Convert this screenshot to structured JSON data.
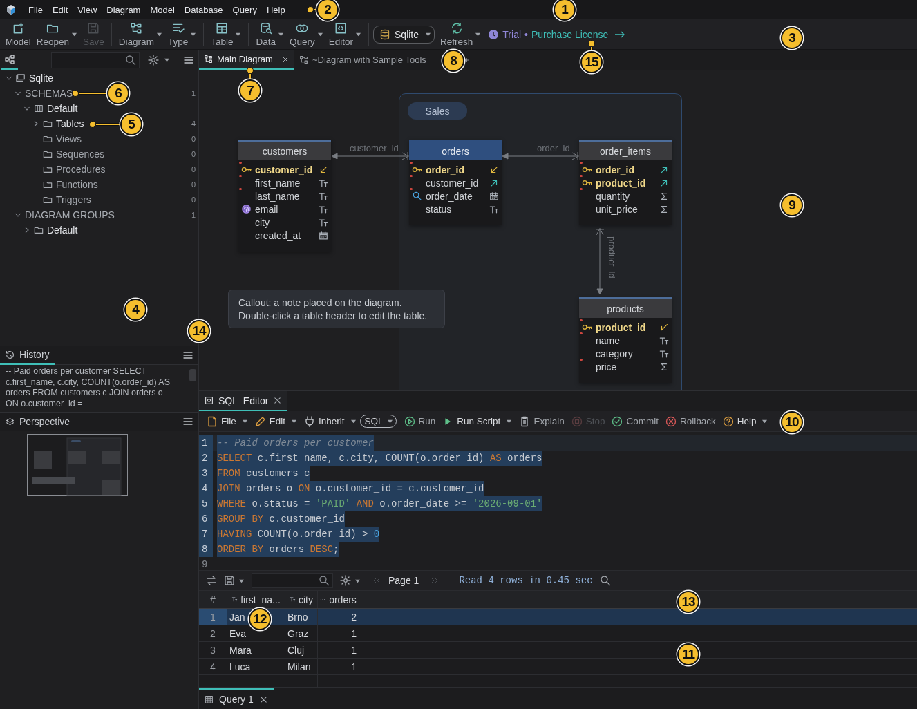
{
  "menu": [
    "File",
    "Edit",
    "View",
    "Diagram",
    "Model",
    "Database",
    "Query",
    "Help"
  ],
  "toolbar": [
    {
      "label": "Model",
      "disabled": false,
      "dropdown": false
    },
    {
      "label": "Reopen",
      "disabled": false,
      "dropdown": true
    },
    {
      "label": "Save",
      "disabled": true,
      "dropdown": false
    },
    {
      "label": "Diagram",
      "disabled": false,
      "dropdown": true
    },
    {
      "label": "Type",
      "disabled": false,
      "dropdown": true
    },
    {
      "label": "Table",
      "disabled": false,
      "dropdown": true
    },
    {
      "label": "Data",
      "disabled": false,
      "dropdown": true
    },
    {
      "label": "Query",
      "disabled": false,
      "dropdown": true
    },
    {
      "label": "Editor",
      "disabled": false,
      "dropdown": true
    }
  ],
  "connection": {
    "label": "Sqlite"
  },
  "refresh": {
    "label": "Refresh"
  },
  "license": {
    "status": "Trial",
    "separator": "•",
    "link": "Purchase License"
  },
  "tree": [
    {
      "label": "Sqlite",
      "expanded": true,
      "children": [
        {
          "label": "SCHEMAS",
          "count": "1",
          "expanded": true,
          "children": [
            {
              "label": "Default",
              "expanded": true,
              "children": [
                {
                  "label": "Tables",
                  "count": "4",
                  "expanded": false
                },
                {
                  "label": "Views",
                  "count": "0"
                },
                {
                  "label": "Sequences",
                  "count": "0"
                },
                {
                  "label": "Procedures",
                  "count": "0"
                },
                {
                  "label": "Functions",
                  "count": "0"
                },
                {
                  "label": "Triggers",
                  "count": "0"
                }
              ]
            }
          ]
        },
        {
          "label": "DIAGRAM GROUPS",
          "count": "1",
          "expanded": true,
          "children": [
            {
              "label": "Default",
              "expanded": false
            }
          ]
        }
      ]
    }
  ],
  "history": {
    "title": "History",
    "text": "-- Paid orders per customer SELECT c.first_name, c.city, COUNT(o.order_id) AS orders FROM customers c JOIN orders o ON o.customer_id ="
  },
  "perspective": {
    "title": "Perspective"
  },
  "diagram_tabs": [
    {
      "label": "Main Diagram",
      "selected": true,
      "closable": true
    },
    {
      "label": "~Diagram with Sample Tools",
      "selected": false,
      "closable": false
    }
  ],
  "diagram": {
    "group": {
      "label": "Sales"
    },
    "tables": [
      {
        "name": "customers",
        "selected": false,
        "columns": [
          {
            "name": "customer_id",
            "key": true,
            "unique": false,
            "indexed": false,
            "required": true,
            "kind": "ref-in"
          },
          {
            "name": "first_name",
            "key": false,
            "unique": false,
            "indexed": false,
            "required": true,
            "kind": "text"
          },
          {
            "name": "last_name",
            "key": false,
            "unique": false,
            "indexed": false,
            "required": true,
            "kind": "text"
          },
          {
            "name": "email",
            "key": false,
            "unique": true,
            "indexed": false,
            "required": false,
            "kind": "text"
          },
          {
            "name": "city",
            "key": false,
            "unique": false,
            "indexed": false,
            "required": false,
            "kind": "text"
          },
          {
            "name": "created_at",
            "key": false,
            "unique": false,
            "indexed": false,
            "required": false,
            "kind": "date"
          }
        ]
      },
      {
        "name": "orders",
        "selected": true,
        "columns": [
          {
            "name": "order_id",
            "key": true,
            "unique": false,
            "indexed": false,
            "required": true,
            "kind": "ref-in"
          },
          {
            "name": "customer_id",
            "key": false,
            "unique": false,
            "indexed": false,
            "required": true,
            "kind": "ref-out"
          },
          {
            "name": "order_date",
            "key": false,
            "unique": false,
            "indexed": true,
            "required": true,
            "kind": "date"
          },
          {
            "name": "status",
            "key": false,
            "unique": false,
            "indexed": false,
            "required": false,
            "kind": "text"
          }
        ]
      },
      {
        "name": "order_items",
        "selected": false,
        "columns": [
          {
            "name": "order_id",
            "key": true,
            "unique": false,
            "indexed": false,
            "required": true,
            "kind": "ref-out"
          },
          {
            "name": "product_id",
            "key": true,
            "unique": false,
            "indexed": false,
            "required": true,
            "kind": "ref-out"
          },
          {
            "name": "quantity",
            "key": false,
            "unique": false,
            "indexed": false,
            "required": true,
            "kind": "number"
          },
          {
            "name": "unit_price",
            "key": false,
            "unique": false,
            "indexed": false,
            "required": false,
            "kind": "number"
          }
        ]
      },
      {
        "name": "products",
        "selected": false,
        "columns": [
          {
            "name": "product_id",
            "key": true,
            "unique": false,
            "indexed": false,
            "required": true,
            "kind": "ref-in"
          },
          {
            "name": "name",
            "key": false,
            "unique": false,
            "indexed": false,
            "required": true,
            "kind": "text"
          },
          {
            "name": "category",
            "key": false,
            "unique": false,
            "indexed": false,
            "required": false,
            "kind": "text"
          },
          {
            "name": "price",
            "key": false,
            "unique": false,
            "indexed": false,
            "required": true,
            "kind": "number"
          }
        ]
      }
    ],
    "relations": [
      {
        "label": "customer_id"
      },
      {
        "label": "order_id"
      },
      {
        "label": "product_id"
      }
    ],
    "callout": {
      "lines": [
        "Callout: a note placed on the diagram.",
        "Double-click a table header to edit the table."
      ]
    }
  },
  "editor_tab": {
    "label": "SQL_Editor"
  },
  "editor_toolbar": [
    {
      "label": "File",
      "dropdown": true,
      "disabled": false
    },
    {
      "label": "Edit",
      "dropdown": true,
      "disabled": false
    },
    {
      "label": "Inherit",
      "dropdown": true,
      "disabled": false
    },
    {
      "label": "SQL",
      "dropdown": true,
      "disabled": false
    },
    {
      "label": "Run",
      "dropdown": false,
      "disabled": false
    },
    {
      "label": "Run Script",
      "dropdown": true,
      "disabled": false
    },
    {
      "label": "Explain",
      "dropdown": false,
      "disabled": false
    },
    {
      "label": "Stop",
      "dropdown": false,
      "disabled": true
    },
    {
      "label": "Commit",
      "dropdown": false,
      "disabled": false
    },
    {
      "label": "Rollback",
      "dropdown": false,
      "disabled": false
    },
    {
      "label": "Help",
      "dropdown": true,
      "disabled": false
    }
  ],
  "code": [
    {
      "number": "1",
      "selected": true,
      "tokens": [
        {
          "kind": "comment",
          "text": "-- Paid orders per customer"
        }
      ]
    },
    {
      "number": "2",
      "selected": true,
      "tokens": [
        {
          "kind": "keyword",
          "text": "SELECT"
        },
        {
          "kind": "plain",
          "text": " c.first_name, c.city, COUNT(o.order_id) "
        },
        {
          "kind": "keyword",
          "text": "AS"
        },
        {
          "kind": "plain",
          "text": " orders"
        }
      ]
    },
    {
      "number": "3",
      "selected": true,
      "tokens": [
        {
          "kind": "keyword",
          "text": "FROM"
        },
        {
          "kind": "plain",
          "text": " customers c"
        }
      ]
    },
    {
      "number": "4",
      "selected": true,
      "tokens": [
        {
          "kind": "keyword",
          "text": "JOIN"
        },
        {
          "kind": "plain",
          "text": " orders o "
        },
        {
          "kind": "keyword",
          "text": "ON"
        },
        {
          "kind": "plain",
          "text": " o.customer_id = c.customer_id"
        }
      ]
    },
    {
      "number": "5",
      "selected": true,
      "tokens": [
        {
          "kind": "keyword",
          "text": "WHERE"
        },
        {
          "kind": "plain",
          "text": " o.status = "
        },
        {
          "kind": "string",
          "text": "'PAID'"
        },
        {
          "kind": "keyword",
          "text": " AND"
        },
        {
          "kind": "plain",
          "text": " o.order_date >= "
        },
        {
          "kind": "string",
          "text": "'2026-09-01'"
        }
      ]
    },
    {
      "number": "6",
      "selected": true,
      "tokens": [
        {
          "kind": "keyword",
          "text": "GROUP BY"
        },
        {
          "kind": "plain",
          "text": " c.customer_id"
        }
      ]
    },
    {
      "number": "7",
      "selected": true,
      "tokens": [
        {
          "kind": "keyword",
          "text": "HAVING"
        },
        {
          "kind": "plain",
          "text": " COUNT(o.order_id) > "
        },
        {
          "kind": "number",
          "text": "0"
        }
      ]
    },
    {
      "number": "8",
      "selected": true,
      "tokens": [
        {
          "kind": "keyword",
          "text": "ORDER BY"
        },
        {
          "kind": "plain",
          "text": " orders "
        },
        {
          "kind": "keyword",
          "text": "DESC"
        },
        {
          "kind": "plain",
          "text": ";"
        }
      ]
    },
    {
      "number": "9",
      "selected": false
    }
  ],
  "results": {
    "page": "Page 1",
    "status": "Read 4 rows in 0.45 sec",
    "columns": [
      {
        "label": "#"
      },
      {
        "label": "first_na...",
        "kind": "text"
      },
      {
        "label": "city",
        "kind": "text"
      },
      {
        "label": "orders",
        "kind": "number"
      }
    ],
    "rows": [
      {
        "selected": true,
        "cells": [
          "1",
          "Jan",
          "Brno",
          "2"
        ]
      },
      {
        "selected": false,
        "cells": [
          "2",
          "Eva",
          "Graz",
          "1"
        ]
      },
      {
        "selected": false,
        "cells": [
          "3",
          "Mara",
          "Cluj",
          "1"
        ]
      },
      {
        "selected": false,
        "cells": [
          "4",
          "Luca",
          "Milan",
          "1"
        ]
      }
    ]
  },
  "result_tab": {
    "label": "Query 1"
  },
  "annotations": [
    {
      "number": "1",
      "leader": false
    },
    {
      "number": "2",
      "leader": true
    },
    {
      "number": "3",
      "leader": false
    },
    {
      "number": "4",
      "leader": false
    },
    {
      "number": "5",
      "leader": true
    },
    {
      "number": "6",
      "leader": true
    },
    {
      "number": "7",
      "leader": true
    },
    {
      "number": "8",
      "leader": false
    },
    {
      "number": "9",
      "leader": false
    },
    {
      "number": "10",
      "leader": false
    },
    {
      "number": "11",
      "leader": false
    },
    {
      "number": "12",
      "leader": false
    },
    {
      "number": "13",
      "leader": false
    },
    {
      "number": "14",
      "leader": false
    },
    {
      "number": "15",
      "leader": true
    }
  ]
}
